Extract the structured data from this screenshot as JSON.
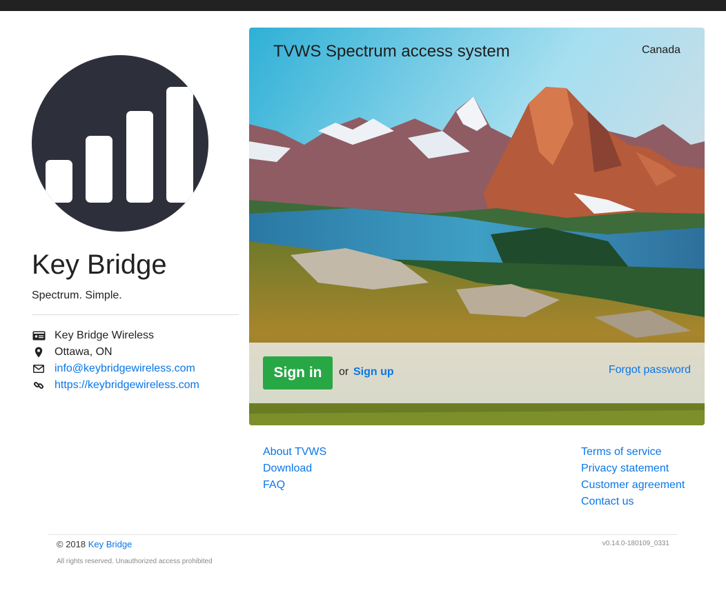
{
  "brand": {
    "name": "Key Bridge",
    "tagline": "Spectrum. Simple.",
    "logo_color": "#2d303b"
  },
  "contact": {
    "company": "Key Bridge Wireless",
    "location": "Ottawa, ON",
    "email": "info@keybridgewireless.com",
    "website": "https://keybridgewireless.com",
    "icons": [
      "id-card-icon",
      "map-marker-icon",
      "envelope-icon",
      "link-icon"
    ]
  },
  "hero": {
    "title": "TVWS Spectrum access system",
    "region": "Canada",
    "signin_label": "Sign in",
    "or_label": "or",
    "signup_label": "Sign up",
    "forgot_label": "Forgot password",
    "signin_color": "#28a745"
  },
  "links": {
    "left": [
      "About TVWS",
      "Download",
      "FAQ"
    ],
    "right": [
      "Terms of service",
      "Privacy statement",
      "Customer agreement",
      "Contact us"
    ]
  },
  "footer": {
    "copyright_prefix": "© 2018",
    "copyright_link": "Key Bridge",
    "version": "v0.14.0-180109_0331",
    "rights": "All rights reserved. Unauthorized access prohibited"
  },
  "colors": {
    "link": "#0a76e6",
    "topbar": "#222222"
  }
}
